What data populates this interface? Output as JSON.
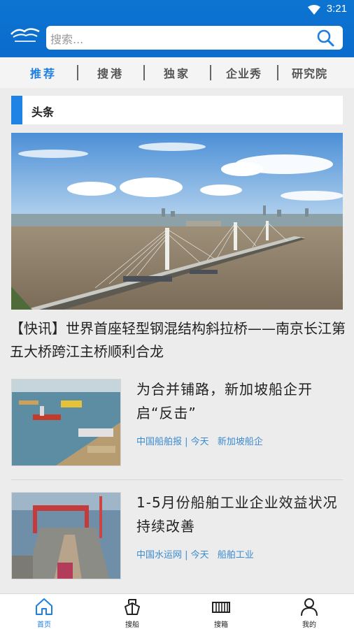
{
  "status": {
    "time": "3:21"
  },
  "search": {
    "placeholder": "搜索..."
  },
  "nav": {
    "items": [
      {
        "label": "推荐"
      },
      {
        "label": "搜港"
      },
      {
        "label": "独家"
      },
      {
        "label": "企业秀"
      },
      {
        "label": "研究院"
      }
    ]
  },
  "section": {
    "title": "头条"
  },
  "hero": {
    "headline": "【快讯】世界首座轻型钢混结构斜拉桥——南京长江第五大桥跨江主桥顺利合龙"
  },
  "news": [
    {
      "title": "为合并铺路，新加坡船企开启“反击”",
      "source": "中国船舶报",
      "date": "今天",
      "tag": "新加坡船企"
    },
    {
      "title": "1-5月份船舶工业企业效益状况持续改善",
      "source": "中国水运网",
      "date": "今天",
      "tag": "船舶工业"
    }
  ],
  "tabbar": {
    "items": [
      {
        "label": "首页"
      },
      {
        "label": "搜船"
      },
      {
        "label": "搜箱"
      },
      {
        "label": "我的"
      }
    ]
  },
  "colors": {
    "brand": "#0d74d2",
    "accent": "#1f83e6",
    "meta": "#3b8bcf"
  }
}
